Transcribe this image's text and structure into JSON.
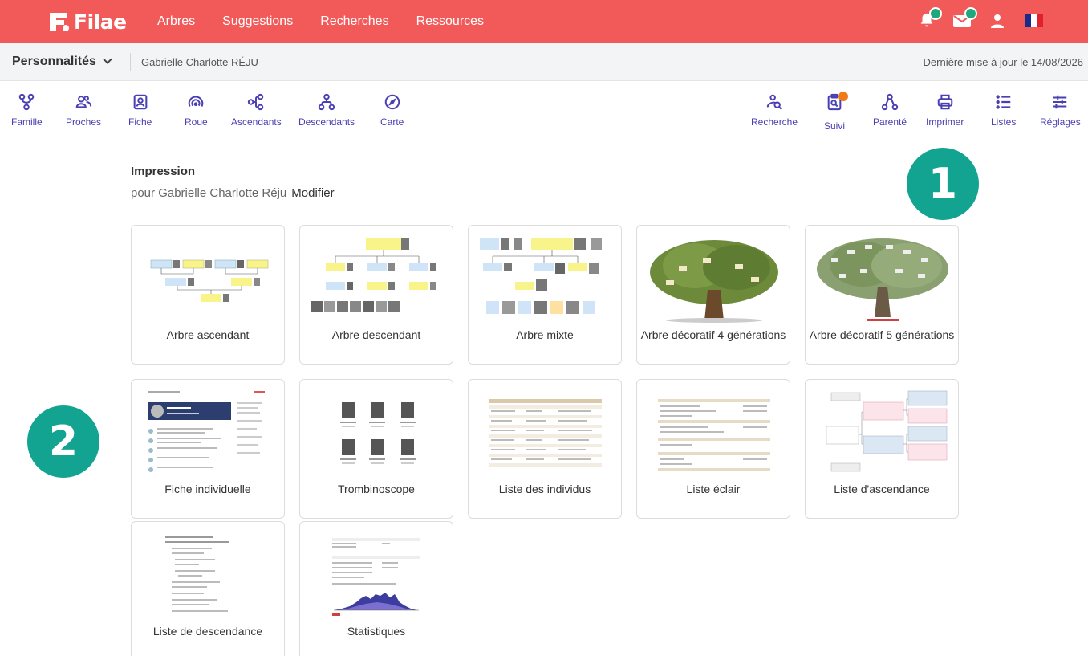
{
  "app": {
    "logo_text": "Filae",
    "nav": [
      "Arbres",
      "Suggestions",
      "Recherches",
      "Ressources"
    ],
    "icons": [
      "bell-icon",
      "mail-icon",
      "user-icon",
      "flag-fr-icon"
    ],
    "brand_color": "#f25a5a"
  },
  "subbar": {
    "persons_label": "Personnalités",
    "person_name": "Gabrielle Charlotte RÉJU",
    "last_update": "Dernière mise à jour le 14/08/2026"
  },
  "toolbar": {
    "left": [
      {
        "label": "Famille",
        "icon": "family-icon"
      },
      {
        "label": "Proches",
        "icon": "people-icon"
      },
      {
        "label": "Fiche",
        "icon": "id-card-icon"
      },
      {
        "label": "Roue",
        "icon": "wheel-icon"
      },
      {
        "label": "Ascendants",
        "icon": "ancestors-icon"
      },
      {
        "label": "Descendants",
        "icon": "descendants-icon"
      },
      {
        "label": "Carte",
        "icon": "compass-icon"
      }
    ],
    "right": [
      {
        "label": "Recherche",
        "icon": "search-people-icon"
      },
      {
        "label": "Suivi",
        "icon": "clipboard-search-icon"
      },
      {
        "label": "Parenté",
        "icon": "relationship-icon"
      },
      {
        "label": "Imprimer",
        "icon": "printer-icon"
      },
      {
        "label": "Listes",
        "icon": "list-icon"
      },
      {
        "label": "Réglages",
        "icon": "sliders-icon"
      }
    ]
  },
  "print": {
    "title": "Impression",
    "for_text": "pour Gabrielle Charlotte Réju",
    "modify_link": "Modifier"
  },
  "badges": [
    "1",
    "2"
  ],
  "cards": [
    {
      "label": "Arbre ascendant",
      "thumb": "tree-chart"
    },
    {
      "label": "Arbre descendant",
      "thumb": "tree-chart"
    },
    {
      "label": "Arbre mixte",
      "thumb": "tree-chart"
    },
    {
      "label": "Arbre décoratif 4 générations",
      "thumb": "decorative-tree"
    },
    {
      "label": "Arbre décoratif 5 générations",
      "thumb": "decorative-tree"
    },
    {
      "label": "Fiche individuelle",
      "thumb": "document"
    },
    {
      "label": "Trombinoscope",
      "thumb": "photo-grid"
    },
    {
      "label": "Liste des individus",
      "thumb": "table"
    },
    {
      "label": "Liste éclair",
      "thumb": "table"
    },
    {
      "label": "Liste d'ascendance",
      "thumb": "pedigree"
    },
    {
      "label": "Liste de descendance",
      "thumb": "text-list"
    },
    {
      "label": "Statistiques",
      "thumb": "stats"
    }
  ]
}
